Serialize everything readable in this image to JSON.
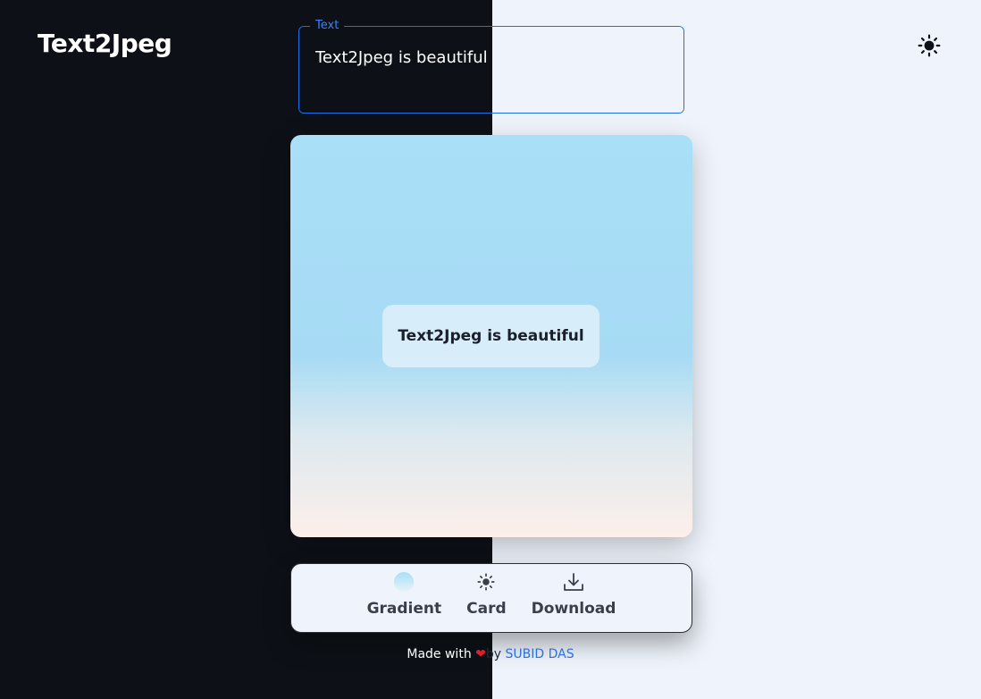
{
  "header": {
    "brand": "Text2Jpeg",
    "theme_icon": "sun-icon"
  },
  "text_field": {
    "label": "Text",
    "value": "Text2Jpeg is beautiful"
  },
  "preview": {
    "text": "Text2Jpeg is beautiful"
  },
  "toolbar": {
    "items": [
      {
        "label": "Gradient",
        "icon": "gradient-dot-icon"
      },
      {
        "label": "Card",
        "icon": "sun-icon"
      },
      {
        "label": "Download",
        "icon": "download-icon"
      }
    ]
  },
  "footer": {
    "made_with": "Made with",
    "heart": "❤",
    "by": "by",
    "author": "SUBID DAS"
  },
  "colors": {
    "dark_bg": "#0d1117",
    "light_bg": "#eff4fc",
    "accent": "#1f6feb",
    "author_link": "#2f6fd8",
    "heart": "#e11d2a"
  }
}
